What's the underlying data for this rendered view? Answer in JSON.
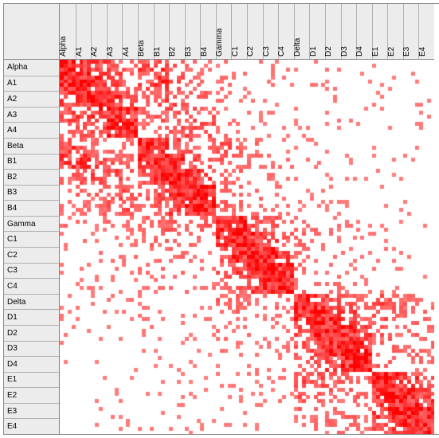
{
  "chart_data": {
    "type": "heatmap",
    "title": "",
    "xlabel": "",
    "ylabel": "",
    "labels": [
      "Alpha",
      "A1",
      "A2",
      "A3",
      "A4",
      "Beta",
      "B1",
      "B2",
      "B3",
      "B4",
      "Gamma",
      "C1",
      "C2",
      "C3",
      "C4",
      "Delta",
      "D1",
      "D2",
      "D3",
      "D4",
      "E1",
      "E2",
      "E3",
      "E4"
    ],
    "colormap": {
      "low": "#ffffff",
      "high": "#ff0000"
    },
    "value_range": [
      0.0,
      1.0
    ],
    "note": "Symmetric 24x24 correlation / similarity matrix. Strong block-diagonal structure: {Alpha..A4}, {Beta..B4}, {Gamma..C4}, {Delta..D4}, {E1..E4}. Diagonal = 1.0. Values estimated from red intensity.",
    "matrix": [
      [
        1.0,
        0.9,
        0.7,
        0.55,
        0.35,
        0.7,
        0.7,
        0.35,
        0.25,
        0.2,
        0.2,
        0.15,
        0.15,
        0.1,
        0.1,
        0.1,
        0.1,
        0.1,
        0.05,
        0.05,
        0.05,
        0.05,
        0.05,
        0.05
      ],
      [
        0.9,
        1.0,
        0.85,
        0.6,
        0.4,
        0.55,
        0.75,
        0.45,
        0.3,
        0.25,
        0.2,
        0.15,
        0.15,
        0.1,
        0.1,
        0.1,
        0.1,
        0.1,
        0.05,
        0.05,
        0.05,
        0.05,
        0.05,
        0.05
      ],
      [
        0.7,
        0.85,
        1.0,
        0.85,
        0.5,
        0.35,
        0.55,
        0.55,
        0.4,
        0.3,
        0.2,
        0.15,
        0.15,
        0.1,
        0.1,
        0.1,
        0.1,
        0.1,
        0.05,
        0.05,
        0.05,
        0.05,
        0.05,
        0.05
      ],
      [
        0.55,
        0.6,
        0.85,
        1.0,
        0.85,
        0.3,
        0.4,
        0.55,
        0.5,
        0.4,
        0.2,
        0.15,
        0.15,
        0.1,
        0.1,
        0.1,
        0.1,
        0.1,
        0.05,
        0.05,
        0.05,
        0.05,
        0.05,
        0.05
      ],
      [
        0.35,
        0.4,
        0.5,
        0.85,
        1.0,
        0.25,
        0.3,
        0.4,
        0.5,
        0.5,
        0.2,
        0.15,
        0.15,
        0.1,
        0.1,
        0.1,
        0.1,
        0.1,
        0.05,
        0.05,
        0.05,
        0.05,
        0.05,
        0.05
      ],
      [
        0.7,
        0.55,
        0.35,
        0.3,
        0.25,
        1.0,
        0.85,
        0.55,
        0.4,
        0.3,
        0.45,
        0.3,
        0.25,
        0.2,
        0.15,
        0.1,
        0.1,
        0.1,
        0.05,
        0.05,
        0.05,
        0.05,
        0.05,
        0.05
      ],
      [
        0.7,
        0.75,
        0.55,
        0.4,
        0.3,
        0.85,
        1.0,
        0.9,
        0.6,
        0.45,
        0.4,
        0.3,
        0.25,
        0.2,
        0.15,
        0.1,
        0.1,
        0.1,
        0.05,
        0.05,
        0.05,
        0.05,
        0.05,
        0.05
      ],
      [
        0.35,
        0.45,
        0.55,
        0.55,
        0.4,
        0.55,
        0.9,
        1.0,
        0.9,
        0.65,
        0.35,
        0.3,
        0.25,
        0.2,
        0.15,
        0.1,
        0.1,
        0.1,
        0.05,
        0.05,
        0.05,
        0.05,
        0.05,
        0.05
      ],
      [
        0.25,
        0.3,
        0.4,
        0.5,
        0.5,
        0.4,
        0.6,
        0.9,
        1.0,
        0.9,
        0.3,
        0.25,
        0.2,
        0.2,
        0.15,
        0.1,
        0.1,
        0.1,
        0.05,
        0.05,
        0.05,
        0.05,
        0.05,
        0.05
      ],
      [
        0.2,
        0.25,
        0.3,
        0.4,
        0.5,
        0.3,
        0.45,
        0.65,
        0.9,
        1.0,
        0.35,
        0.25,
        0.2,
        0.2,
        0.15,
        0.1,
        0.1,
        0.1,
        0.05,
        0.05,
        0.05,
        0.05,
        0.05,
        0.05
      ],
      [
        0.2,
        0.2,
        0.2,
        0.2,
        0.2,
        0.45,
        0.4,
        0.35,
        0.3,
        0.35,
        1.0,
        0.85,
        0.55,
        0.4,
        0.3,
        0.35,
        0.25,
        0.2,
        0.15,
        0.1,
        0.1,
        0.1,
        0.05,
        0.05
      ],
      [
        0.15,
        0.15,
        0.15,
        0.15,
        0.15,
        0.3,
        0.3,
        0.3,
        0.25,
        0.25,
        0.85,
        1.0,
        0.9,
        0.6,
        0.45,
        0.3,
        0.25,
        0.2,
        0.15,
        0.1,
        0.1,
        0.1,
        0.05,
        0.05
      ],
      [
        0.15,
        0.15,
        0.15,
        0.15,
        0.15,
        0.25,
        0.25,
        0.25,
        0.2,
        0.2,
        0.55,
        0.9,
        1.0,
        0.9,
        0.65,
        0.25,
        0.2,
        0.2,
        0.15,
        0.1,
        0.1,
        0.1,
        0.05,
        0.05
      ],
      [
        0.1,
        0.1,
        0.1,
        0.1,
        0.1,
        0.2,
        0.2,
        0.2,
        0.2,
        0.2,
        0.4,
        0.6,
        0.9,
        1.0,
        0.9,
        0.25,
        0.2,
        0.2,
        0.15,
        0.1,
        0.1,
        0.1,
        0.05,
        0.05
      ],
      [
        0.1,
        0.1,
        0.1,
        0.1,
        0.1,
        0.15,
        0.15,
        0.15,
        0.15,
        0.15,
        0.3,
        0.45,
        0.65,
        0.9,
        1.0,
        0.3,
        0.2,
        0.2,
        0.15,
        0.1,
        0.1,
        0.1,
        0.05,
        0.05
      ],
      [
        0.1,
        0.1,
        0.1,
        0.1,
        0.1,
        0.1,
        0.1,
        0.1,
        0.1,
        0.1,
        0.35,
        0.3,
        0.25,
        0.25,
        0.3,
        1.0,
        0.85,
        0.6,
        0.45,
        0.3,
        0.55,
        0.4,
        0.3,
        0.25
      ],
      [
        0.1,
        0.1,
        0.1,
        0.1,
        0.1,
        0.1,
        0.1,
        0.1,
        0.1,
        0.1,
        0.25,
        0.25,
        0.2,
        0.2,
        0.2,
        0.85,
        1.0,
        0.9,
        0.65,
        0.45,
        0.5,
        0.4,
        0.3,
        0.25
      ],
      [
        0.1,
        0.1,
        0.1,
        0.1,
        0.1,
        0.1,
        0.1,
        0.1,
        0.1,
        0.1,
        0.2,
        0.2,
        0.2,
        0.2,
        0.2,
        0.6,
        0.9,
        1.0,
        0.9,
        0.65,
        0.45,
        0.4,
        0.3,
        0.25
      ],
      [
        0.05,
        0.05,
        0.05,
        0.05,
        0.05,
        0.05,
        0.05,
        0.05,
        0.05,
        0.05,
        0.15,
        0.15,
        0.15,
        0.15,
        0.15,
        0.45,
        0.65,
        0.9,
        1.0,
        0.9,
        0.4,
        0.35,
        0.3,
        0.25
      ],
      [
        0.05,
        0.05,
        0.05,
        0.05,
        0.05,
        0.05,
        0.05,
        0.05,
        0.05,
        0.05,
        0.1,
        0.1,
        0.1,
        0.1,
        0.1,
        0.3,
        0.45,
        0.65,
        0.9,
        1.0,
        0.35,
        0.3,
        0.3,
        0.25
      ],
      [
        0.05,
        0.05,
        0.05,
        0.05,
        0.05,
        0.05,
        0.05,
        0.05,
        0.05,
        0.05,
        0.1,
        0.1,
        0.1,
        0.1,
        0.1,
        0.55,
        0.5,
        0.45,
        0.4,
        0.35,
        1.0,
        0.9,
        0.7,
        0.5
      ],
      [
        0.05,
        0.05,
        0.05,
        0.05,
        0.05,
        0.05,
        0.05,
        0.05,
        0.05,
        0.05,
        0.1,
        0.1,
        0.1,
        0.1,
        0.1,
        0.4,
        0.4,
        0.4,
        0.35,
        0.3,
        0.9,
        1.0,
        0.9,
        0.7
      ],
      [
        0.05,
        0.05,
        0.05,
        0.05,
        0.05,
        0.05,
        0.05,
        0.05,
        0.05,
        0.05,
        0.05,
        0.05,
        0.05,
        0.05,
        0.05,
        0.3,
        0.3,
        0.3,
        0.3,
        0.3,
        0.7,
        0.9,
        1.0,
        0.9
      ],
      [
        0.05,
        0.05,
        0.05,
        0.05,
        0.05,
        0.05,
        0.05,
        0.05,
        0.05,
        0.05,
        0.05,
        0.05,
        0.05,
        0.05,
        0.05,
        0.25,
        0.25,
        0.25,
        0.25,
        0.25,
        0.5,
        0.7,
        0.9,
        1.0
      ]
    ]
  }
}
